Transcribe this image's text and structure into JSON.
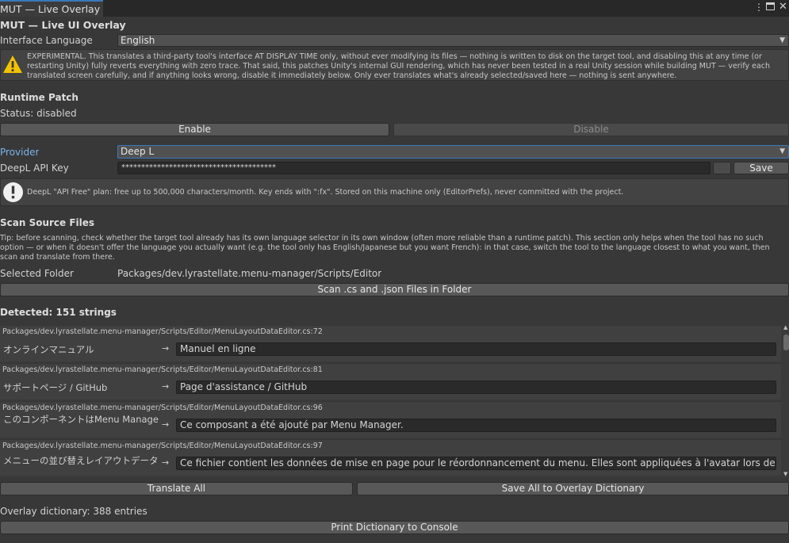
{
  "window": {
    "tab_title": "MUT — Live Overlay",
    "menu_icon": "kebab-icon",
    "maximize_icon": "maximize-icon",
    "close_icon": "close-icon"
  },
  "header": {
    "title": "MUT — Live UI Overlay"
  },
  "language": {
    "label": "Interface Language",
    "value": "English"
  },
  "warning": {
    "icon": "warning-icon",
    "text": "EXPERIMENTAL. This translates a third-party tool's interface AT DISPLAY TIME only, without ever modifying its files — nothing is written to disk on the target tool, and disabling this at any time (or restarting Unity) fully reverts everything with zero trace. That said, this patches Unity's internal GUI rendering, which has never been tested in a real Unity session while building MUT — verify each translated screen carefully, and if anything looks wrong, disable it immediately below. Only ever translates what's already selected/saved here — nothing is sent anywhere."
  },
  "runtime_patch": {
    "title": "Runtime Patch",
    "status": "Status: disabled",
    "enable_label": "Enable",
    "disable_label": "Disable"
  },
  "provider": {
    "label": "Provider",
    "value": "Deep L",
    "api_key_label": "DeepL API Key",
    "api_key_value": "***************************************",
    "save_label": "Save"
  },
  "info": {
    "icon": "info-icon",
    "text": "DeepL \"API Free\" plan: free up to 500,000 characters/month. Key ends with \":fx\". Stored on this machine only (EditorPrefs), never committed with the project."
  },
  "scan": {
    "title": "Scan Source Files",
    "tip": "Tip: before scanning, check whether the target tool already has its own language selector in its own window (often more reliable than a runtime patch). This section only helps when the tool has no such option — or when it doesn't offer the language you actually want (e.g. the tool only has English/Japanese but you want French): in that case, switch the tool to the language closest to what you want, then scan and translate from there.",
    "folder_label": "Selected Folder",
    "folder_value": "Packages/dev.lyrastellate.menu-manager/Scripts/Editor",
    "scan_button": "Scan .cs and .json Files in Folder"
  },
  "detected": {
    "title": "Detected: 151 strings",
    "entries": [
      {
        "path": "Packages/dev.lyrastellate.menu-manager/Scripts/Editor/MenuLayoutDataEditor.cs:72",
        "source": "オンラインマニュアル",
        "target": "Manuel en ligne"
      },
      {
        "path": "Packages/dev.lyrastellate.menu-manager/Scripts/Editor/MenuLayoutDataEditor.cs:81",
        "source": "サポートページ / GitHub",
        "target": "Page d'assistance / GitHub"
      },
      {
        "path": "Packages/dev.lyrastellate.menu-manager/Scripts/Editor/MenuLayoutDataEditor.cs:96",
        "source": "このコンポーネントはMenu Manage",
        "target": "Ce composant a été ajouté par Menu Manager."
      },
      {
        "path": "Packages/dev.lyrastellate.menu-manager/Scripts/Editor/MenuLayoutDataEditor.cs:97",
        "source": "メニューの並び替えレイアウトデータ",
        "target": "Ce fichier contient les données de mise en page pour le réordonnancement du menu. Elles sont appliquées à l'avatar lors de la compilation."
      }
    ],
    "arrow": "→",
    "translate_all": "Translate All",
    "save_all": "Save All to Overlay Dictionary"
  },
  "dictionary": {
    "status": "Overlay dictionary: 388 entries",
    "print_button": "Print Dictionary to Console"
  },
  "colors": {
    "background": "#383838",
    "accent": "#3a79bb",
    "link": "#7ab4ee"
  }
}
